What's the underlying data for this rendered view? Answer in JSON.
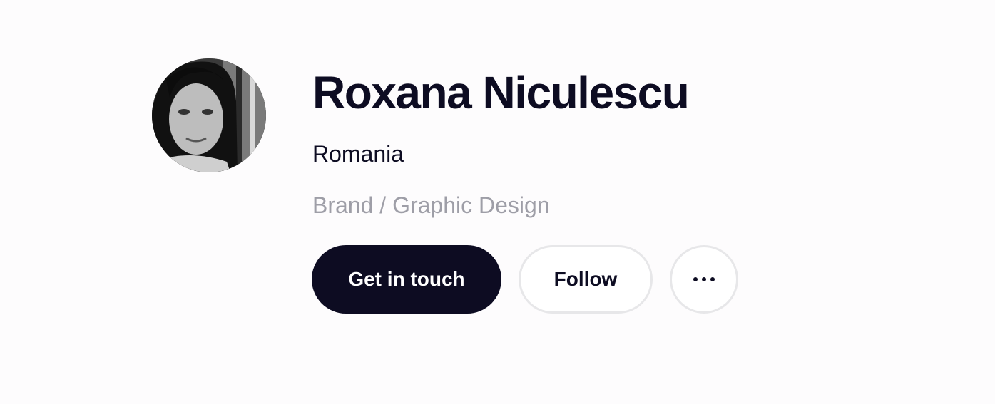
{
  "profile": {
    "name": "Roxana Niculescu",
    "location": "Romania",
    "discipline": "Brand / Graphic Design",
    "avatar_alt": "profile photo"
  },
  "actions": {
    "primary_label": "Get in touch",
    "follow_label": "Follow",
    "more_icon": "more-horizontal-icon"
  },
  "colors": {
    "ink": "#0d0c22",
    "muted": "#9e9ea7",
    "border": "#e7e7e9",
    "background": "#fdfcfd"
  }
}
